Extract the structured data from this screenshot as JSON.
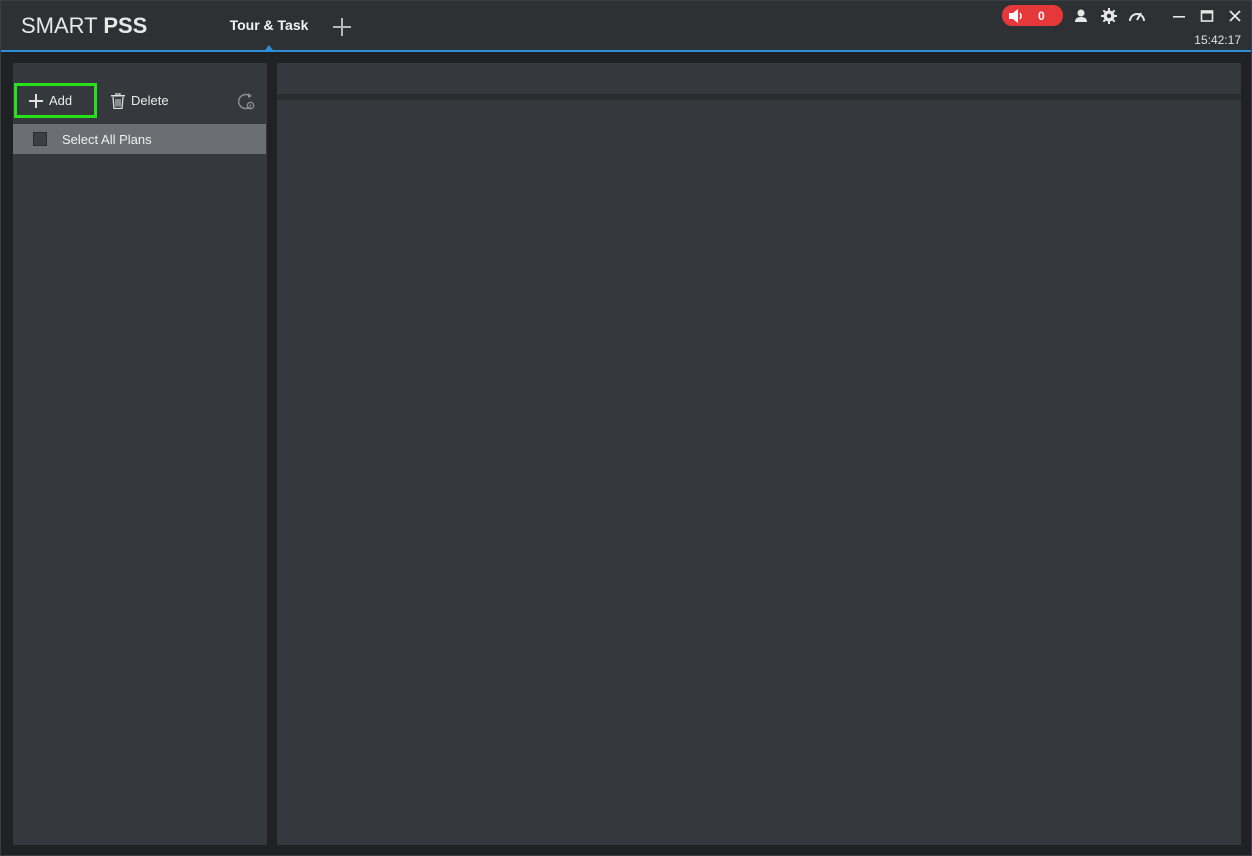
{
  "app": {
    "logo_light": "SMART ",
    "logo_bold": "PSS"
  },
  "tabs": [
    {
      "label": "Tour & Task",
      "active": true
    }
  ],
  "header": {
    "alarm_count": "0",
    "clock": "15:42:17",
    "icons": [
      "speaker-icon",
      "user-icon",
      "gear-icon",
      "speedometer-icon",
      "minimize-icon",
      "maximize-icon",
      "close-icon"
    ]
  },
  "left_panel": {
    "add_label": "Add",
    "delete_label": "Delete",
    "select_all_label": "Select All Plans"
  },
  "colors": {
    "accent": "#2a8fd8",
    "alarm": "#e5383b",
    "highlight": "#27e11a"
  }
}
